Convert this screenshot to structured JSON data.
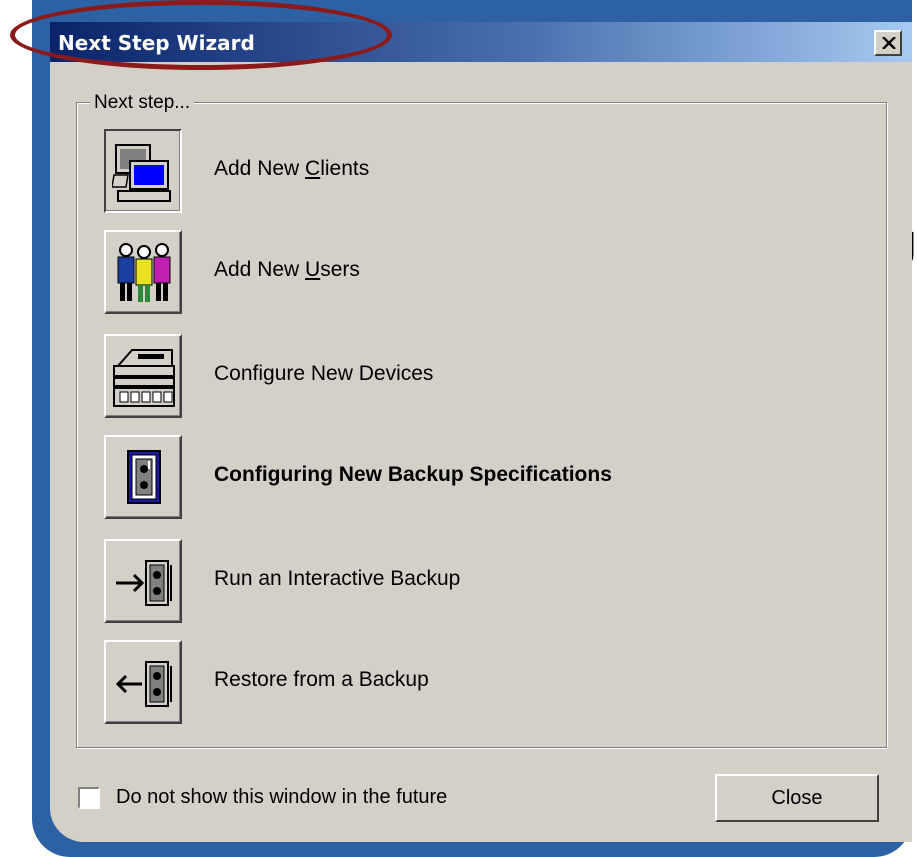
{
  "window": {
    "title": "Next Step Wizard",
    "close_icon": "close-x-icon"
  },
  "group": {
    "legend": "Next step..."
  },
  "steps": [
    {
      "label": "Add New Clients",
      "mnemonic": "C",
      "icon": "computer-icon",
      "bold": false
    },
    {
      "label": "Add New Users",
      "mnemonic": "U",
      "icon": "users-icon",
      "bold": false
    },
    {
      "label": "Configure New Devices",
      "icon": "tape-device-icon",
      "bold": false
    },
    {
      "label": "Configuring New Backup Specifications",
      "icon": "backup-spec-icon",
      "bold": true
    },
    {
      "label": "Run an Interactive Backup",
      "icon": "backup-arrow-right-icon",
      "bold": false
    },
    {
      "label": "Restore from a Backup",
      "icon": "restore-arrow-left-icon",
      "bold": false
    }
  ],
  "footer": {
    "checkbox_label": "Do not show this window in the future",
    "checkbox_checked": false,
    "close_label": "Close"
  },
  "slide": {
    "partial_char": "J",
    "frame_color": "#2c62a3",
    "highlight_color": "#8b1a1a"
  }
}
